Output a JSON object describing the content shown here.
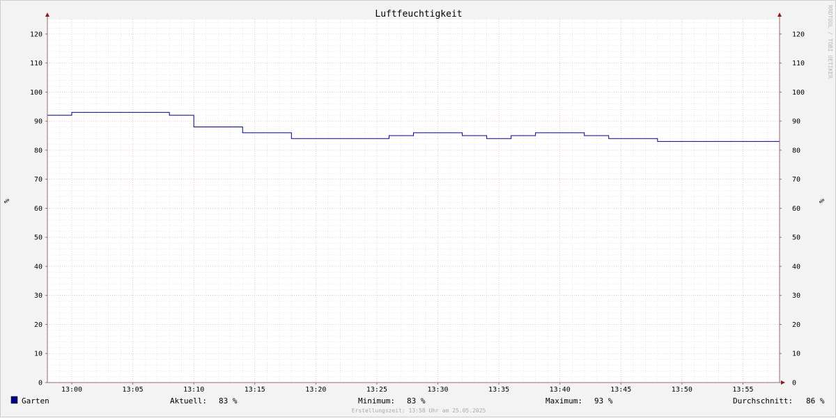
{
  "chart_data": {
    "type": "line",
    "title": "Luftfeuchtigkeit",
    "ylabel": "%",
    "ylim": [
      0,
      125
    ],
    "yticks": [
      "0",
      "10",
      "20",
      "30",
      "40",
      "50",
      "60",
      "70",
      "80",
      "90",
      "100",
      "110",
      "120"
    ],
    "xlim": [
      "12:58",
      "13:58"
    ],
    "xticks": [
      "13:00",
      "13:05",
      "13:10",
      "13:15",
      "13:20",
      "13:25",
      "13:30",
      "13:35",
      "13:40",
      "13:45",
      "13:50",
      "13:55"
    ],
    "grid": true,
    "series": [
      {
        "name": "Garten",
        "color": "#000080",
        "x": [
          "12:58",
          "13:00",
          "13:08",
          "13:10",
          "13:14",
          "13:16",
          "13:18",
          "13:26",
          "13:28",
          "13:32",
          "13:34",
          "13:36",
          "13:38",
          "13:42",
          "13:44",
          "13:48",
          "13:58"
        ],
        "values": [
          92,
          93,
          92,
          88,
          86,
          86,
          84,
          85,
          86,
          85,
          84,
          85,
          86,
          85,
          84,
          83,
          83
        ]
      }
    ],
    "watermark": "RRDTOOL / TOBI OETIKER"
  },
  "legend": {
    "series_label": "Garten",
    "series_color": "#000080",
    "stats": [
      {
        "label": "Aktuell:",
        "value": "83 %"
      },
      {
        "label": "Minimum:",
        "value": "83 %"
      },
      {
        "label": "Maximum:",
        "value": "93 %"
      },
      {
        "label": "Durchschnitt:",
        "value": "86 %"
      }
    ]
  },
  "footnote": "Erstellungszeit: 13:58 Uhr am 25.05.2025"
}
